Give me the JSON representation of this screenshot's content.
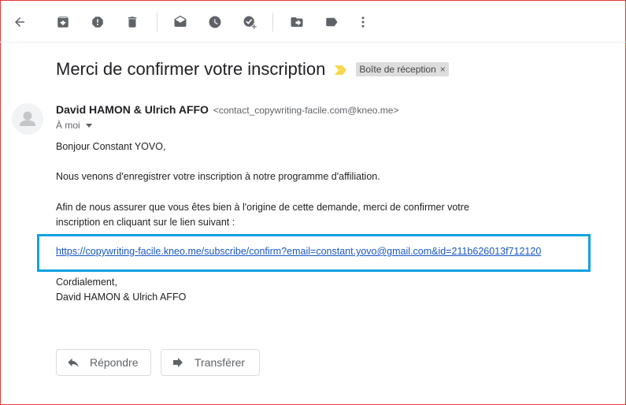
{
  "toolbar": {
    "back_icon": "arrow-back-icon",
    "icons": [
      "archive-icon",
      "report-spam-icon",
      "delete-icon",
      "mark-unread-icon",
      "snooze-icon",
      "add-to-tasks-icon",
      "move-to-icon",
      "label-icon",
      "more-vert-icon"
    ]
  },
  "email": {
    "subject": "Merci de confirmer votre inscription",
    "label": "Boîte de réception",
    "label_close": "×",
    "sender_name": "David HAMON & Ulrich AFFO",
    "sender_address": "<contact_copywriting-facile.com@kneo.me>",
    "to_me": "À moi",
    "greeting": "Bonjour Constant YOVO,",
    "para1": "Nous venons d'enregistrer votre inscription à notre programme d'affiliation.",
    "para2_line1": "Afin de nous assurer que vous êtes bien à l'origine de cette demande, merci de confirmer votre",
    "para2_line2": "inscription en cliquant sur le lien suivant :",
    "link": "https://copywriting-facile.kneo.me/subscribe/confirm?email=constant.yovo@gmail.com&id=211b626013f712120",
    "closing": "Cordialement,",
    "signature": "David HAMON & Ulrich AFFO"
  },
  "actions": {
    "reply": "Répondre",
    "forward": "Transférer"
  },
  "colors": {
    "highlight_border": "#10a2e0",
    "link": "#1a57c5",
    "importance_marker": "#f9d74e",
    "frame_border": "#e53935"
  }
}
